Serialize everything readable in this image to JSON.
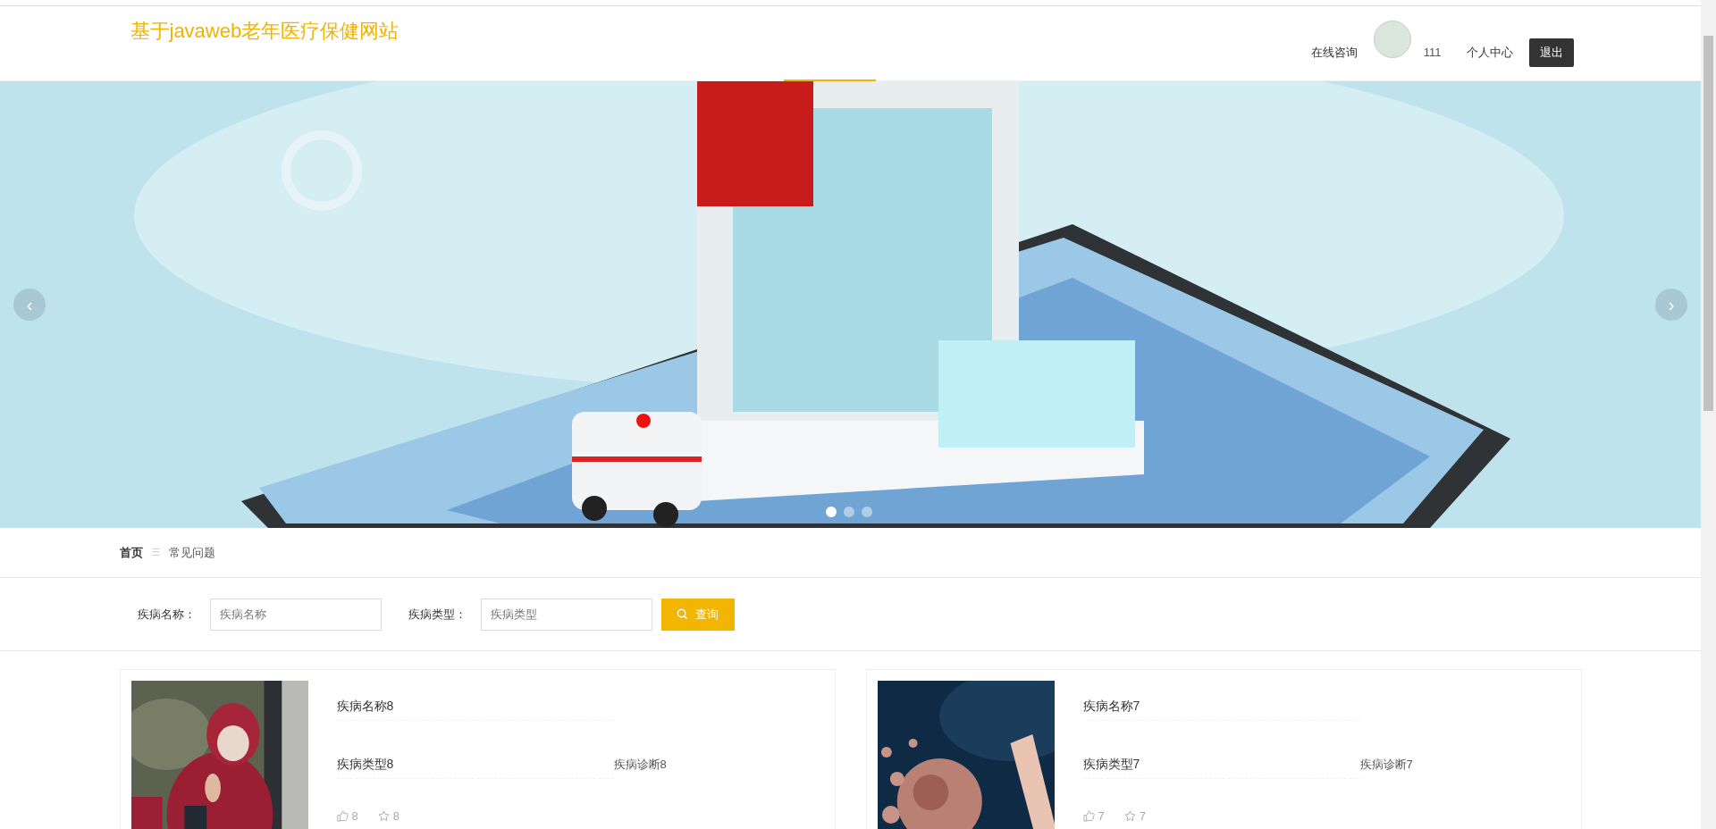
{
  "header": {
    "title": "基于javaweb老年医疗保健网站",
    "nav": [
      {
        "kind": "link",
        "label": "在线咨询"
      },
      {
        "kind": "avatar"
      },
      {
        "kind": "text",
        "label": "111"
      },
      {
        "kind": "link",
        "label": "个人中心"
      },
      {
        "kind": "button",
        "label": "退出"
      }
    ]
  },
  "carousel": {
    "prev": "‹",
    "next": "›",
    "dots": [
      {
        "selected": true
      },
      {
        "selected": false
      },
      {
        "selected": false
      }
    ]
  },
  "breadcrumb": {
    "home": "首页",
    "separator": "☰",
    "current": "常见问题"
  },
  "search": {
    "fields": [
      {
        "label": "疾病名称：",
        "placeholder": "疾病名称"
      },
      {
        "label": "疾病类型：",
        "placeholder": "疾病类型"
      }
    ],
    "button": "查询"
  },
  "cards": [
    {
      "kind": "picture",
      "name": "疾病名称8",
      "type": "疾病类型8",
      "diagnosis": "疾病诊断8",
      "likes": "8",
      "favorites": "8"
    },
    {
      "kind": "picture",
      "name": "疾病名称7",
      "type": "疾病类型7",
      "diagnosis": "疾病诊断7",
      "likes": "7",
      "favorites": "7"
    }
  ]
}
